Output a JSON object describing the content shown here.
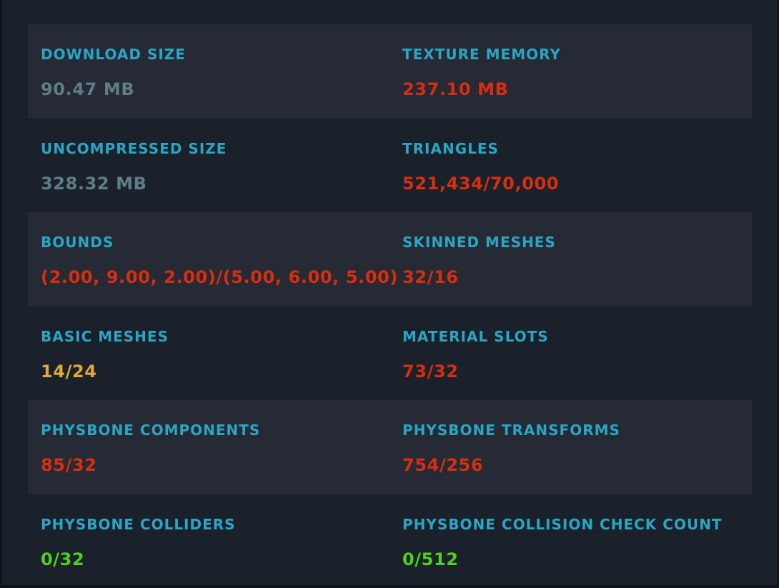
{
  "colors": {
    "label": "#2aa6c4",
    "neutral": "#5f7d86",
    "bad": "#d82e10",
    "warn": "#e2a838",
    "good": "#4fcf1e"
  },
  "stats": [
    {
      "label": "DOWNLOAD SIZE",
      "value": "90.47 MB",
      "status": "neutral"
    },
    {
      "label": "TEXTURE MEMORY",
      "value": "237.10 MB",
      "status": "bad"
    },
    {
      "label": "UNCOMPRESSED SIZE",
      "value": "328.32 MB",
      "status": "neutral"
    },
    {
      "label": "TRIANGLES",
      "value": "521,434/70,000",
      "status": "bad"
    },
    {
      "label": "BOUNDS",
      "value": "(2.00, 9.00, 2.00)/(5.00, 6.00, 5.00)",
      "status": "bad"
    },
    {
      "label": "SKINNED MESHES",
      "value": "32/16",
      "status": "bad"
    },
    {
      "label": "BASIC MESHES",
      "value": "14/24",
      "status": "warn"
    },
    {
      "label": "MATERIAL SLOTS",
      "value": "73/32",
      "status": "bad"
    },
    {
      "label": "PHYSBONE COMPONENTS",
      "value": "85/32",
      "status": "bad"
    },
    {
      "label": "PHYSBONE TRANSFORMS",
      "value": "754/256",
      "status": "bad"
    },
    {
      "label": "PHYSBONE COLLIDERS",
      "value": "0/32",
      "status": "good"
    },
    {
      "label": "PHYSBONE COLLISION CHECK COUNT",
      "value": "0/512",
      "status": "good"
    }
  ]
}
